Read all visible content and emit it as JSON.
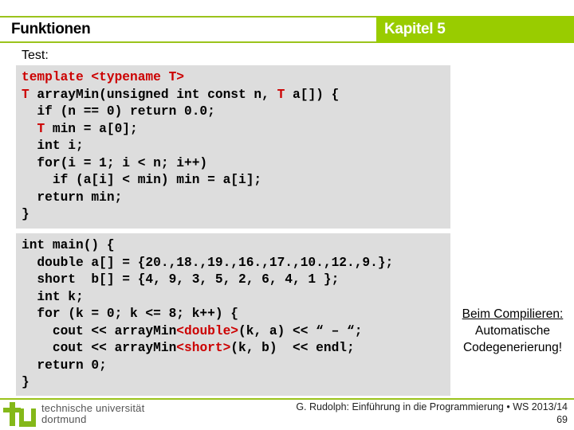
{
  "header": {
    "title": "Funktionen",
    "chapter": "Kapitel 5",
    "accent_color": "#99cc00"
  },
  "section_label": "Test:",
  "code_block_1": {
    "lines": [
      [
        {
          "t": "template <typename T>",
          "red": true
        }
      ],
      [
        {
          "t": "T",
          "red": true
        },
        {
          "t": " arrayMin(unsigned int const n, "
        },
        {
          "t": "T",
          "red": true
        },
        {
          "t": " a[]) {"
        }
      ],
      [
        {
          "t": "  if (n == 0) return 0.0;"
        }
      ],
      [
        {
          "t": "  "
        },
        {
          "t": "T",
          "red": true
        },
        {
          "t": " min = a[0];"
        }
      ],
      [
        {
          "t": "  int i;"
        }
      ],
      [
        {
          "t": "  for(i = 1; i < n; i++)"
        }
      ],
      [
        {
          "t": "    if (a[i] < min) min = a[i];"
        }
      ],
      [
        {
          "t": "  return min;"
        }
      ],
      [
        {
          "t": "}"
        }
      ]
    ]
  },
  "code_block_2": {
    "lines": [
      [
        {
          "t": "int main() {"
        }
      ],
      [
        {
          "t": "  double a[] = {20.,18.,19.,16.,17.,10.,12.,9.};"
        }
      ],
      [
        {
          "t": "  short  b[] = {4, 9, 3, 5, 2, 6, 4, 1 };"
        }
      ],
      [
        {
          "t": "  int k;"
        }
      ],
      [
        {
          "t": "  for (k = 0; k <= 8; k++) {"
        }
      ],
      [
        {
          "t": "    cout << arrayMin"
        },
        {
          "t": "<double>",
          "red": true
        },
        {
          "t": "(k, a) << “ – “;"
        }
      ],
      [
        {
          "t": "    cout << arrayMin"
        },
        {
          "t": "<short>",
          "red": true
        },
        {
          "t": "(k, b)  << endl;"
        }
      ],
      [
        {
          "t": "  return 0;"
        }
      ],
      [
        {
          "t": "}"
        }
      ]
    ]
  },
  "note": {
    "heading": "Beim Compilieren:",
    "line1": "Automatische",
    "line2": "Codegenerierung!"
  },
  "footer": {
    "logo_line1": "technische universität",
    "logo_line2": "dortmund",
    "credit": "G. Rudolph: Einführung in die Programmierung • WS 2013/14",
    "page_number": "69"
  }
}
